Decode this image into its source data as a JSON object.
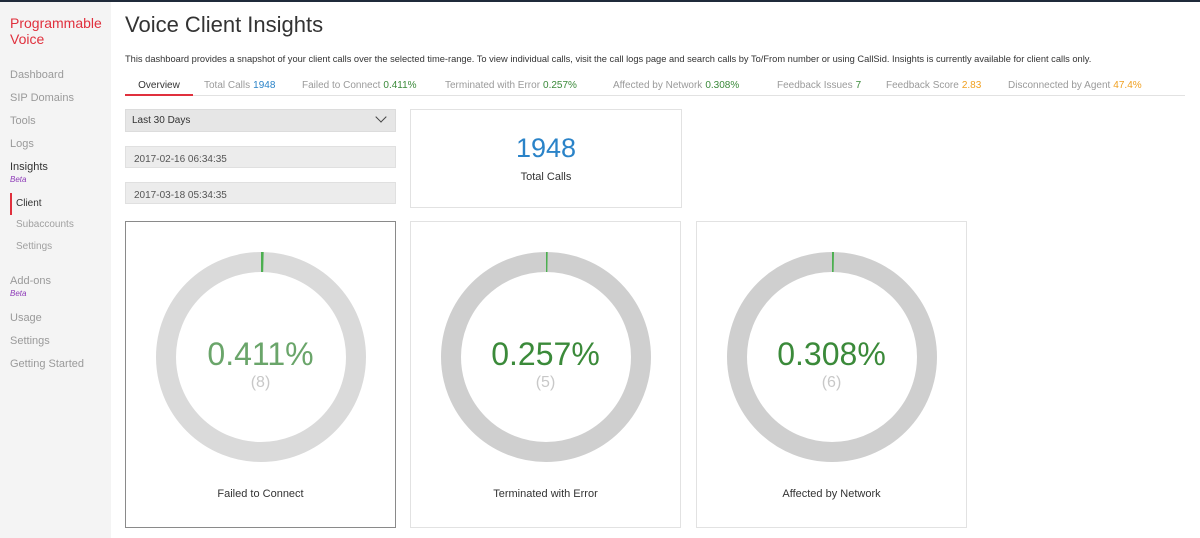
{
  "sidebar": {
    "brand": "Programmable Voice",
    "items": [
      {
        "label": "Dashboard"
      },
      {
        "label": "SIP Domains"
      },
      {
        "label": "Tools"
      },
      {
        "label": "Logs"
      },
      {
        "label": "Insights",
        "badge": "Beta"
      },
      {
        "label": "Add-ons",
        "badge": "Beta"
      },
      {
        "label": "Usage"
      },
      {
        "label": "Settings"
      },
      {
        "label": "Getting Started"
      }
    ],
    "insights_sub": [
      {
        "label": "Client"
      },
      {
        "label": "Subaccounts"
      },
      {
        "label": "Settings"
      }
    ]
  },
  "header": {
    "title": "Voice Client Insights",
    "description": "This dashboard provides a snapshot of your client calls over the selected time-range. To view individual calls, visit the call logs page and search calls by To/From number or using CallSid. Insights is currently available for client calls only."
  },
  "tabs": [
    {
      "label": "Overview"
    },
    {
      "label": "Total Calls",
      "value": "1948"
    },
    {
      "label": "Failed to Connect",
      "value": "0.411%"
    },
    {
      "label": "Terminated with Error",
      "value": "0.257%"
    },
    {
      "label": "Affected by Network",
      "value": "0.308%"
    },
    {
      "label": "Feedback Issues",
      "value": "7"
    },
    {
      "label": "Feedback Score",
      "value": "2.83"
    },
    {
      "label": "Disconnected by Agent",
      "value": "47.4%"
    }
  ],
  "filters": {
    "range": "Last 30 Days",
    "start": "2017-02-16 06:34:35",
    "end": "2017-03-18 05:34:35"
  },
  "total": {
    "value": "1948",
    "label": "Total Calls"
  },
  "gauges": [
    {
      "percent_text": "0.411%",
      "count_text": "(8)",
      "label": "Failed to Connect",
      "fraction": 0.00411
    },
    {
      "percent_text": "0.257%",
      "count_text": "(5)",
      "label": "Terminated with Error",
      "fraction": 0.00257
    },
    {
      "percent_text": "0.308%",
      "count_text": "(6)",
      "label": "Affected by Network",
      "fraction": 0.00308
    }
  ],
  "colors": {
    "brand": "#e0303d",
    "blue": "#2a83c8",
    "green": "#3b8a3a",
    "orange": "#f0a020",
    "ring": "#d6d6d6",
    "beta": "#8e3cb8"
  },
  "icons": {
    "dropdown": "chevron-down-icon"
  }
}
